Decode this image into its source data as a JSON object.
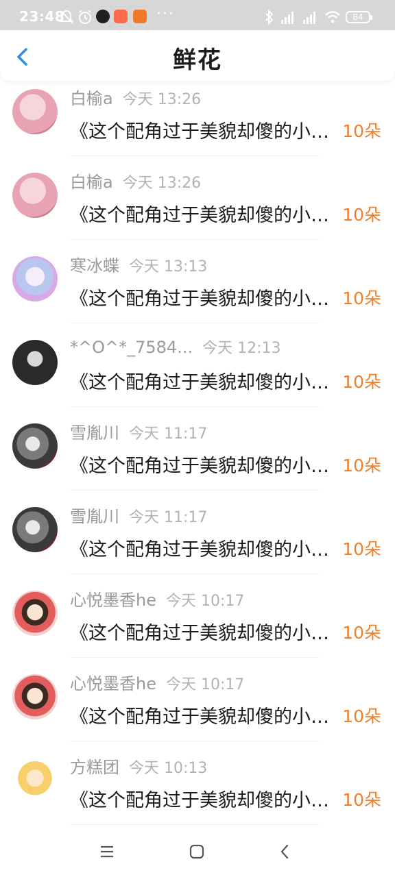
{
  "status_bar": {
    "time": "23:48",
    "battery": "84",
    "icons": [
      "bell-off-icon",
      "alarm-icon",
      "app-icon",
      "app-icon",
      "app-icon",
      "bluetooth-icon",
      "signal-icon",
      "signal-icon",
      "wifi-icon"
    ]
  },
  "header": {
    "title": "鲜花",
    "back_icon": "chevron-left-icon"
  },
  "colors": {
    "accent_blue": "#2f8fe6",
    "amount_orange": "#ef7f2b",
    "status_bar_bg": "#d7d7d7"
  },
  "items": [
    {
      "user": "白榆a",
      "time": "今天 13:26",
      "content": "《这个配角过于美貌却傻的小说》",
      "amount": "10朵"
    },
    {
      "user": "白榆a",
      "time": "今天 13:26",
      "content": "《这个配角过于美貌却傻的小说》",
      "amount": "10朵"
    },
    {
      "user": "寒冰蝶",
      "time": "今天 13:13",
      "content": "《这个配角过于美貌却傻的小说》",
      "amount": "10朵"
    },
    {
      "user": "*^O^*_7584...",
      "time": "今天 12:13",
      "content": "《这个配角过于美貌却傻的小说》",
      "amount": "10朵"
    },
    {
      "user": "雪胤川",
      "time": "今天 11:17",
      "content": "《这个配角过于美貌却傻的小说》",
      "amount": "10朵"
    },
    {
      "user": "雪胤川",
      "time": "今天 11:17",
      "content": "《这个配角过于美貌却傻的小说》",
      "amount": "10朵"
    },
    {
      "user": "心悦墨香he",
      "time": "今天 10:17",
      "content": "《这个配角过于美貌却傻的小说》",
      "amount": "10朵"
    },
    {
      "user": "心悦墨香he",
      "time": "今天 10:17",
      "content": "《这个配角过于美貌却傻的小说》",
      "amount": "10朵"
    },
    {
      "user": "方糕团",
      "time": "今天 10:13",
      "content": "《这个配角过于美貌却傻的小说》",
      "amount": "10朵"
    }
  ],
  "nav_bar": {
    "buttons": [
      "menu-icon",
      "home-icon",
      "back-icon"
    ]
  }
}
